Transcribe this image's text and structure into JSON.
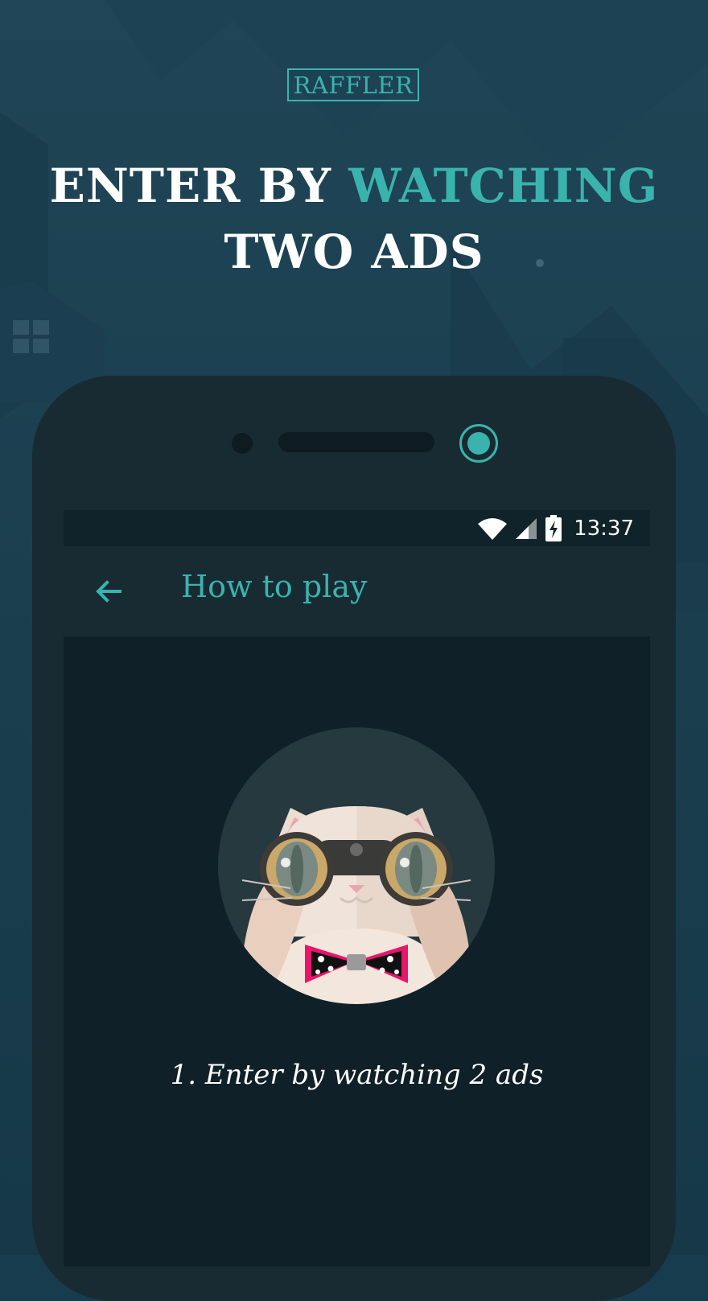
{
  "brand": {
    "logo_text": "RAFFLER"
  },
  "headline": {
    "part1": "ENTER BY ",
    "accent": "WATCHING",
    "line2": "TWO ADS"
  },
  "status_bar": {
    "time": "13:37",
    "icons": [
      "wifi-icon",
      "signal-icon",
      "battery-charging-icon"
    ]
  },
  "app_bar": {
    "title": "How to play",
    "back_icon": "arrow-left-icon"
  },
  "content": {
    "illustration": "cat-with-binoculars-illustration",
    "step_caption": "1. Enter by watching 2 ads"
  },
  "colors": {
    "accent": "#3ab3ad",
    "background": "#173c4e",
    "phone_body": "#182b33",
    "screen": "#0f2028",
    "bow_tie_border": "#e8156a"
  }
}
